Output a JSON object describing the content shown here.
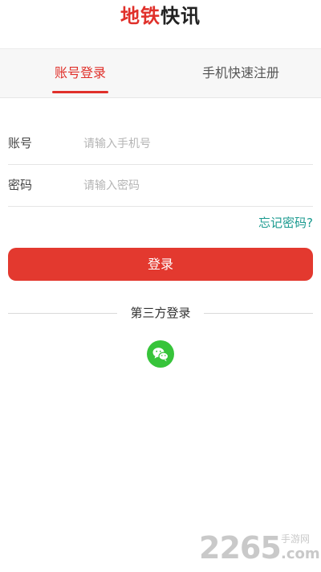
{
  "header": {
    "logo_part_a": "地铁",
    "logo_part_b": "快讯"
  },
  "tabs": [
    {
      "label": "账号登录",
      "active": true
    },
    {
      "label": "手机快速注册",
      "active": false
    }
  ],
  "form": {
    "account_label": "账号",
    "account_placeholder": "请输入手机号",
    "password_label": "密码",
    "password_placeholder": "请输入密码",
    "forgot_label": "忘记密码?",
    "login_label": "登录"
  },
  "third_party": {
    "title": "第三方登录",
    "wechat_icon": "wechat-icon"
  },
  "watermark": {
    "number": "2265",
    "cn": "手游网",
    "com": ".com"
  },
  "colors": {
    "accent": "#e0302a",
    "button": "#e3392f",
    "link": "#1a9a8f",
    "wechat": "#37c43a"
  }
}
